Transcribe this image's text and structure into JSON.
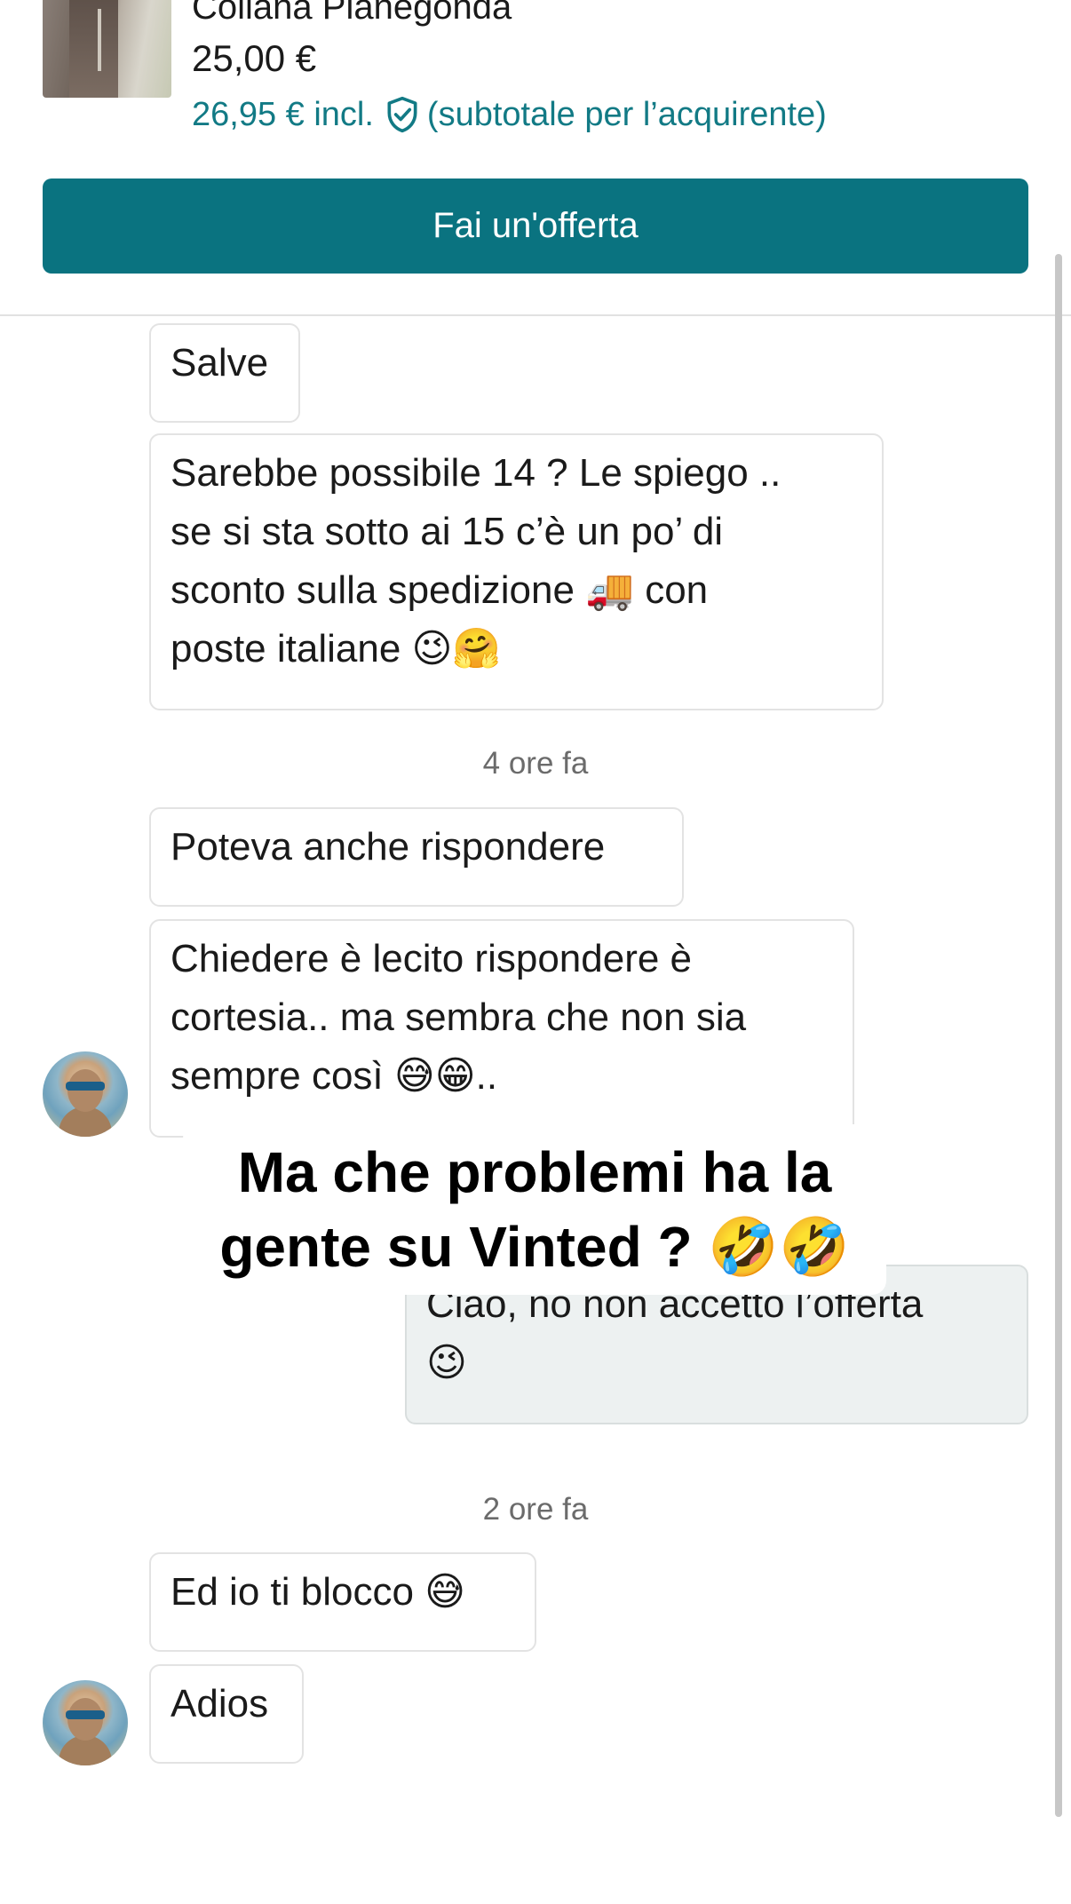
{
  "product": {
    "title": "Collana Pianegonda",
    "price": "25,00 €",
    "price_incl": "26,95 € incl.",
    "price_incl_note": "(subtotale per l’acquirente)"
  },
  "offer_button": {
    "label": "Fai un'offerta"
  },
  "messages": [
    {
      "text": "Salve"
    },
    {
      "lines": [
        "Sarebbe possibile 14 ? Le spiego ..",
        "se si sta sotto ai 15  c’è un po’ di",
        "sconto sulla spedizione 🚚 con",
        "poste italiane 😉🤗"
      ]
    },
    {
      "timestamp": "4 ore fa"
    },
    {
      "text": "Poteva anche rispondere"
    },
    {
      "lines": [
        "Chiedere è lecito rispondere è",
        "cortesia.. ma sembra che non sia",
        "sempre così 😅😁.."
      ]
    },
    {
      "lines": [
        "Ciao, no non accetto l’offerta",
        "😉"
      ]
    },
    {
      "timestamp": "2 ore fa"
    },
    {
      "text": "Ed io ti blocco 😅"
    },
    {
      "text": "Adios"
    }
  ],
  "overlay_caption": {
    "line1": "Ma che problemi ha la",
    "line2": "gente su Vinted ? 🤣🤣"
  },
  "colors": {
    "accent": "#0a7380",
    "price_incl": "#127a85",
    "own_bubble": "#edf1f1"
  },
  "icons": [
    "shield-check-icon"
  ]
}
